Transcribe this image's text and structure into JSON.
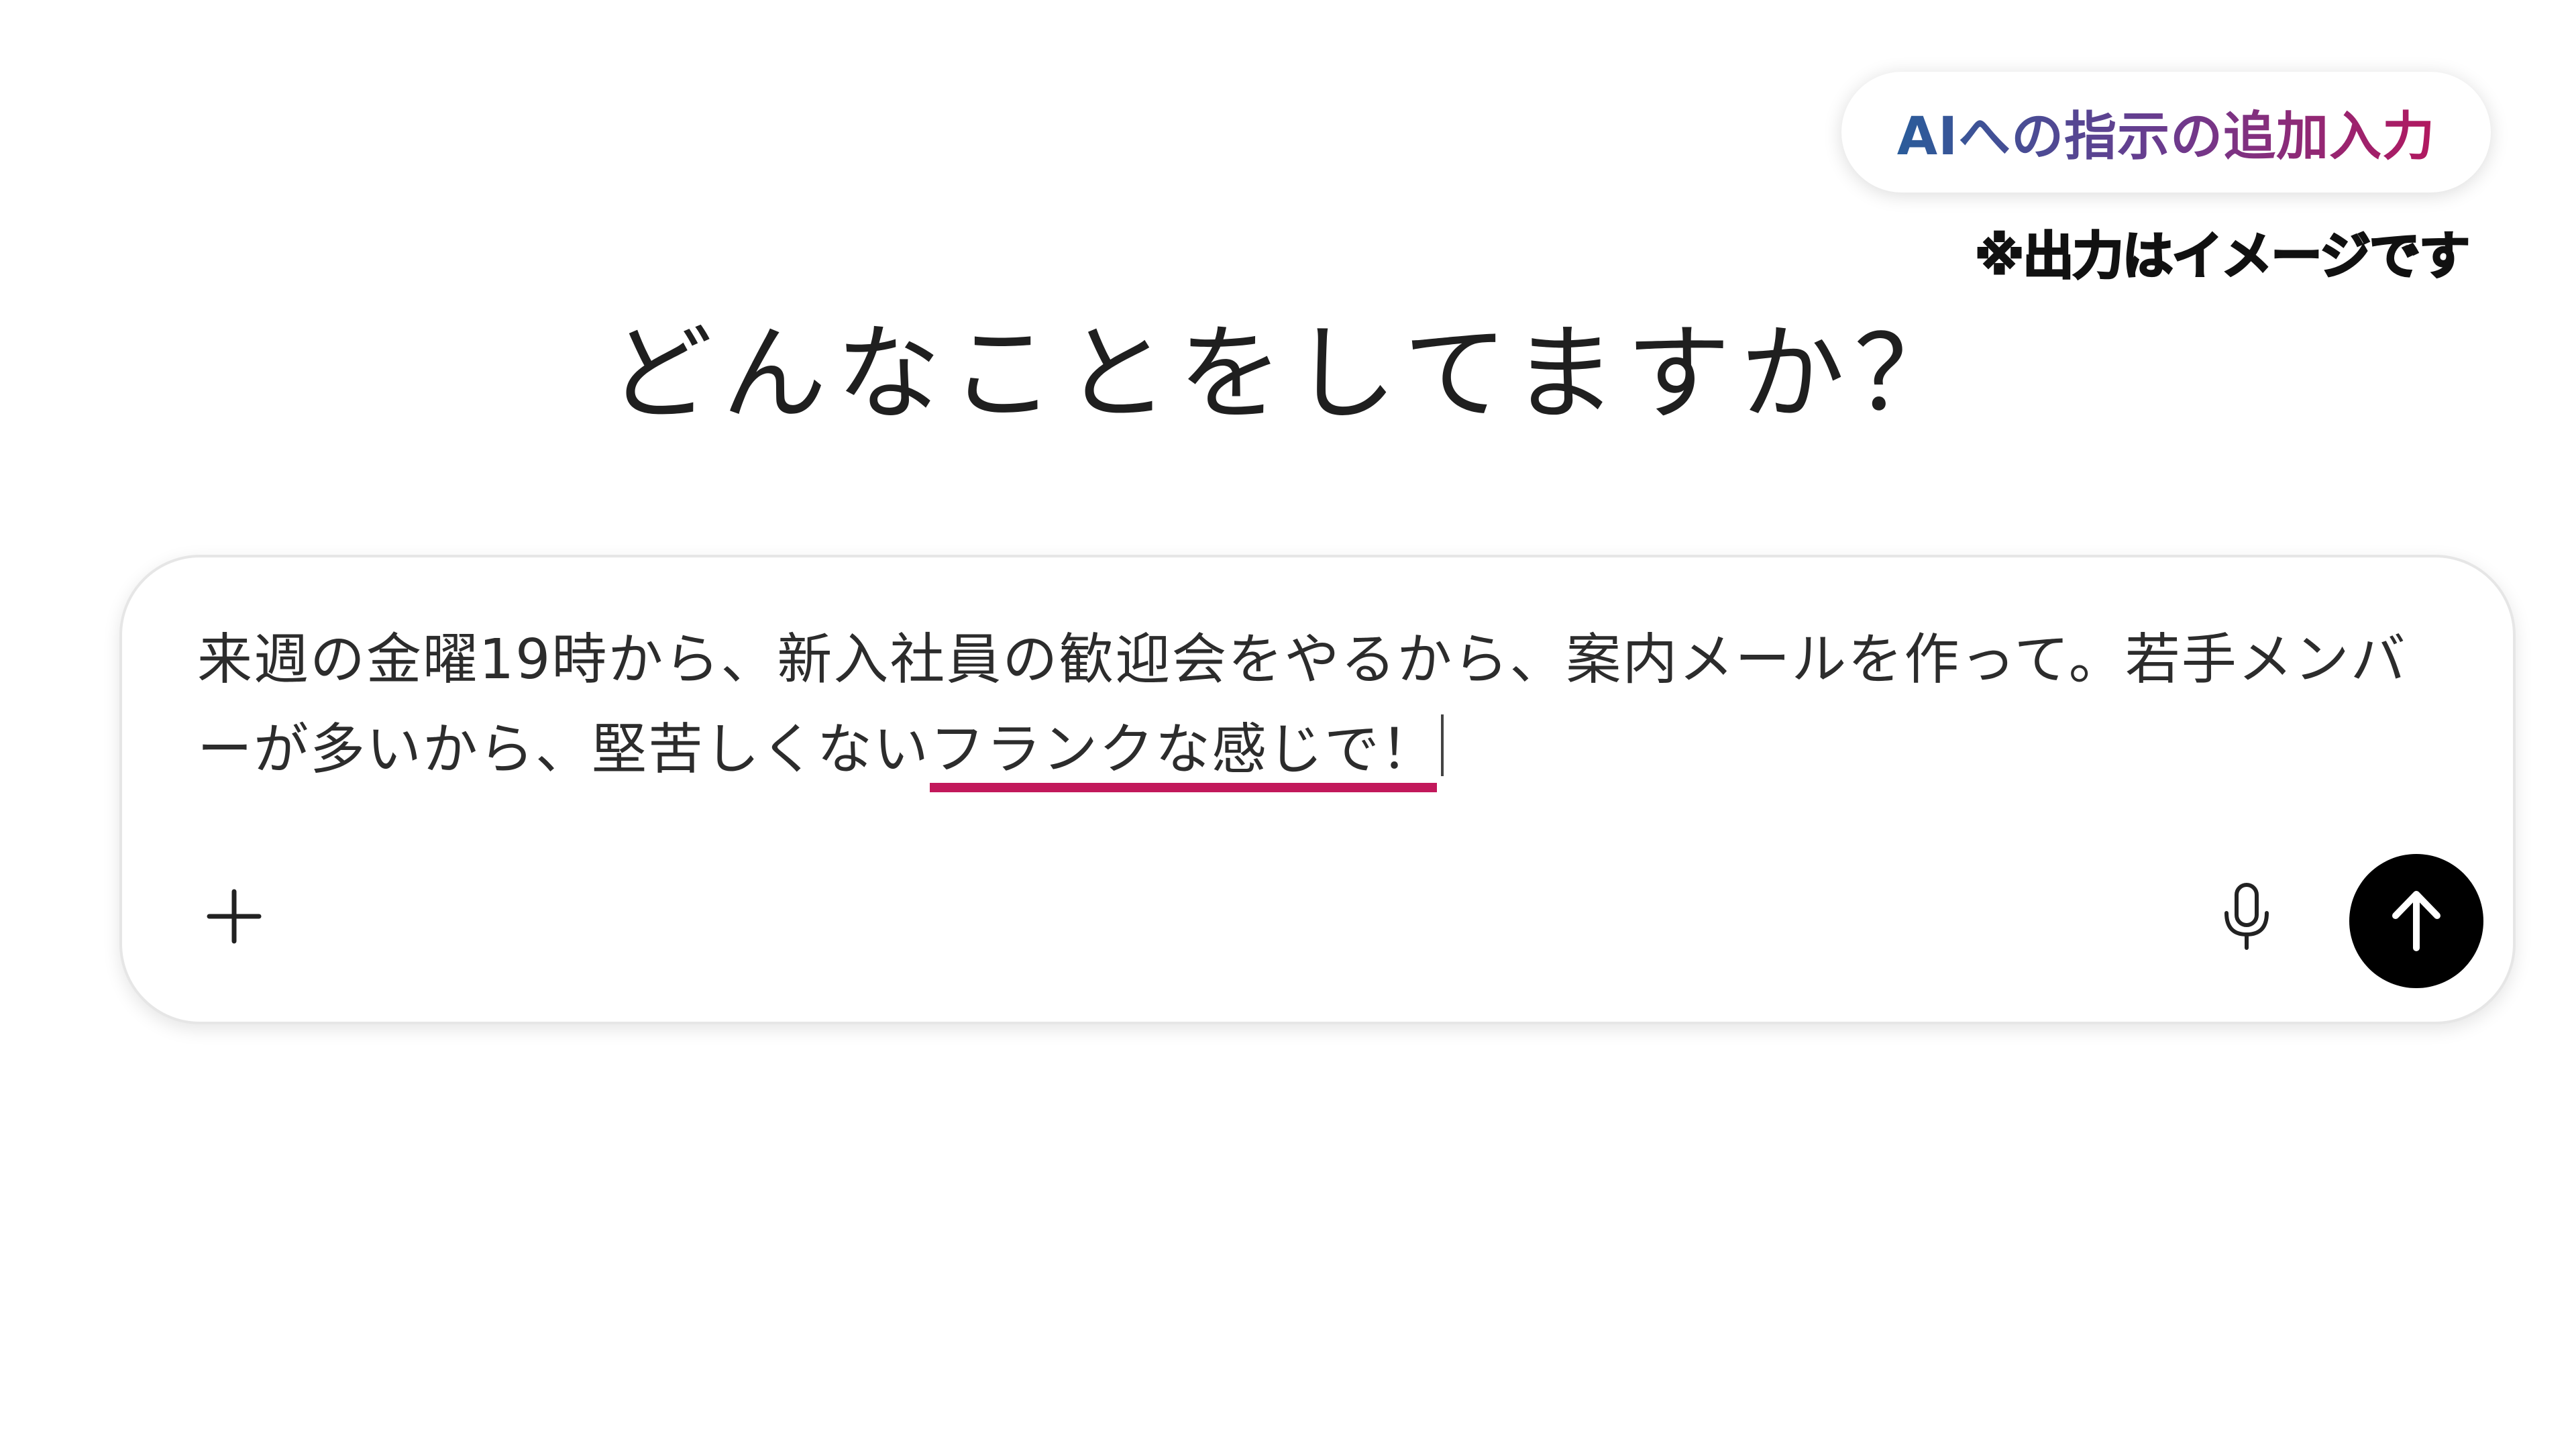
{
  "overlay": {
    "badge_label": "AIへの指示の追加入力",
    "note": "※出力はイメージです",
    "badge_gradient": [
      "#2a5c9a",
      "#6b3b8e",
      "#b2185f"
    ]
  },
  "main": {
    "heading": "どんなことをしてますか？"
  },
  "composer": {
    "text_before_highlight": "来週の金曜19時から、新入社員の歓迎会をやるから、案内メールを作って。若手メンバーが多いから、堅苦しくない",
    "text_highlight": "フランクな感じで！",
    "highlight_color": "#c2185b",
    "icons": {
      "add": "plus-icon",
      "voice": "microphone-icon",
      "send": "arrow-up-icon"
    },
    "send_button_color": "#000000"
  }
}
